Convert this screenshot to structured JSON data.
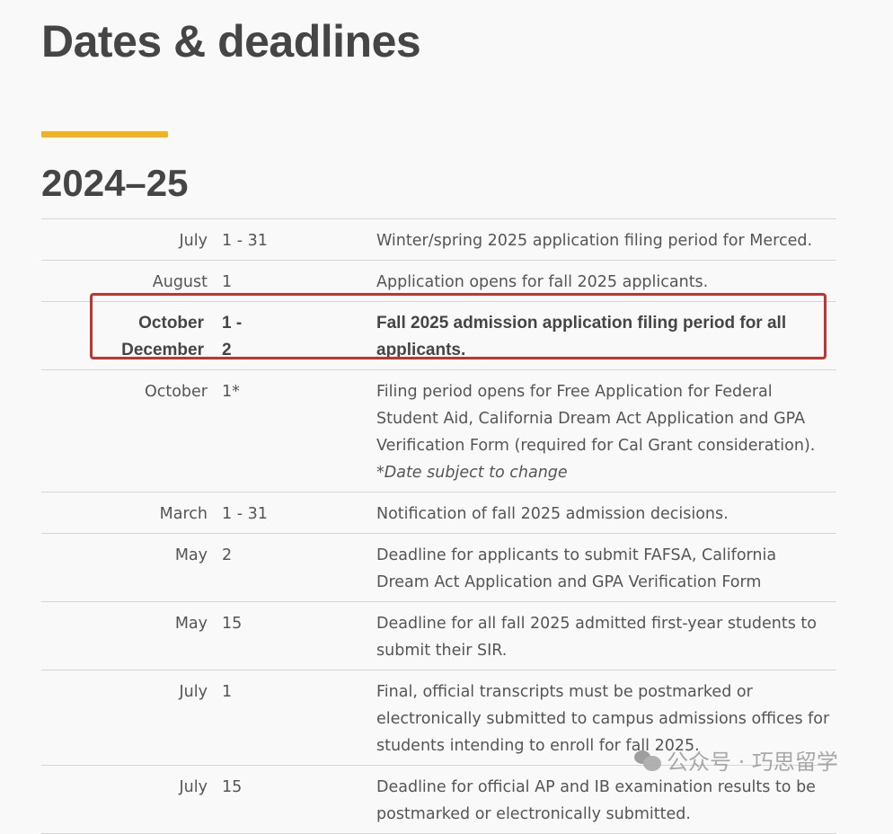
{
  "page": {
    "title": "Dates & deadlines",
    "accent_color": "#f0b323",
    "section_heading": "2024–25"
  },
  "table": {
    "rows": [
      {
        "month": "July",
        "day": "1 - 31",
        "description": "Winter/spring 2025 application filing period for Merced.",
        "note": ""
      },
      {
        "month": "August",
        "day": "1",
        "description": "Application opens for fall 2025 applicants.",
        "note": ""
      },
      {
        "month": "October",
        "month2": "December",
        "day": "1 -",
        "day2": "2",
        "description": "Fall 2025 admission application filing period for all applicants.",
        "note": "",
        "highlighted": true
      },
      {
        "month": "October",
        "day": "1*",
        "description": "Filing period opens for Free Application for Federal Student Aid, California Dream Act Application and GPA Verification Form (required for Cal Grant consideration).",
        "note": "*Date subject to change"
      },
      {
        "month": "March",
        "day": "1 - 31",
        "description": "Notification of fall 2025 admission decisions.",
        "note": ""
      },
      {
        "month": "May",
        "day": "2",
        "description": "Deadline for applicants to submit FAFSA, California Dream Act Application and GPA Verification Form",
        "note": ""
      },
      {
        "month": "May",
        "day": "15",
        "description": "Deadline for all fall 2025 admitted first-year students to submit their SIR.",
        "note": ""
      },
      {
        "month": "July",
        "day": "1",
        "description": "Final, official transcripts must be postmarked or electronically submitted to campus admissions offices for students intending to enroll for fall 2025.",
        "note": ""
      },
      {
        "month": "July",
        "day": "15",
        "description": "Deadline for official AP and IB examination results to be postmarked or electronically submitted.",
        "note": ""
      }
    ]
  },
  "highlight": {
    "color": "#c0352f"
  },
  "watermark": {
    "icon": "wechat-icon",
    "text": "公众号 · 巧思留学"
  }
}
